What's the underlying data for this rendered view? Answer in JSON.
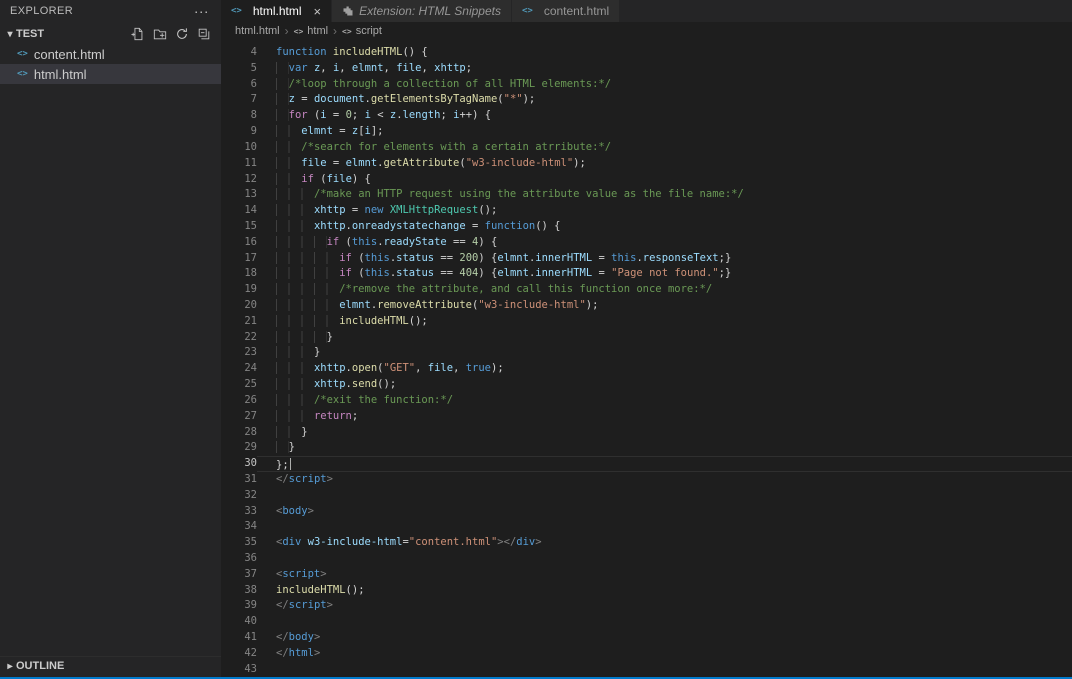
{
  "colors": {
    "accent": "#007acc",
    "editor_bg": "#1e1e1e",
    "sidebar_bg": "#252526",
    "selection_bg": "#37373d",
    "tab_inactive_bg": "#2d2d2d",
    "comment": "#6a9955",
    "keyword": "#569cd6",
    "control_keyword": "#c586c0",
    "string": "#ce9178",
    "function_name": "#dcdcaa",
    "variable": "#9cdcfe"
  },
  "icons": {
    "html_file": "<>",
    "close": "×",
    "more": "···",
    "chevron_down": "▾",
    "chevron_right": "▸",
    "breadcrumb_sep": "›",
    "crumb_symbol": "<>"
  },
  "sidebar": {
    "title": "EXPLORER",
    "section": "TEST",
    "files": [
      {
        "name": "content.html",
        "selected": false
      },
      {
        "name": "html.html",
        "selected": true
      }
    ],
    "outline_label": "OUTLINE"
  },
  "tabs": [
    {
      "label": "html.html",
      "active": true
    },
    {
      "label": "Extension: HTML Snippets",
      "preview": true
    },
    {
      "label": "content.html"
    }
  ],
  "breadcrumb": {
    "items": [
      "html.html",
      "html",
      "script"
    ]
  },
  "editor": {
    "language": "html",
    "current_line": 30,
    "lines": [
      {
        "n": 4,
        "t": [
          [
            "k",
            "function"
          ],
          [
            "p",
            " "
          ],
          [
            "f",
            "includeHTML"
          ],
          [
            "p",
            "() {"
          ]
        ]
      },
      {
        "n": 5,
        "t": [
          [
            "p",
            "  "
          ],
          [
            "k",
            "var"
          ],
          [
            "p",
            " "
          ],
          [
            "v",
            "z"
          ],
          [
            "p",
            ", "
          ],
          [
            "v",
            "i"
          ],
          [
            "p",
            ", "
          ],
          [
            "v",
            "elmnt"
          ],
          [
            "p",
            ", "
          ],
          [
            "v",
            "file"
          ],
          [
            "p",
            ", "
          ],
          [
            "v",
            "xhttp"
          ],
          [
            "p",
            ";"
          ]
        ]
      },
      {
        "n": 6,
        "t": [
          [
            "p",
            "  "
          ],
          [
            "c",
            "/*loop through a collection of all HTML elements:*/"
          ]
        ]
      },
      {
        "n": 7,
        "t": [
          [
            "p",
            "  "
          ],
          [
            "v",
            "z"
          ],
          [
            "p",
            " = "
          ],
          [
            "v",
            "document"
          ],
          [
            "p",
            "."
          ],
          [
            "f",
            "getElementsByTagName"
          ],
          [
            "p",
            "("
          ],
          [
            "s",
            "\"*\""
          ],
          [
            "p",
            ");"
          ]
        ]
      },
      {
        "n": 8,
        "t": [
          [
            "p",
            "  "
          ],
          [
            "ct",
            "for"
          ],
          [
            "p",
            " ("
          ],
          [
            "v",
            "i"
          ],
          [
            "p",
            " = "
          ],
          [
            "n",
            "0"
          ],
          [
            "p",
            "; "
          ],
          [
            "v",
            "i"
          ],
          [
            "p",
            " < "
          ],
          [
            "v",
            "z"
          ],
          [
            "p",
            "."
          ],
          [
            "v",
            "length"
          ],
          [
            "p",
            "; "
          ],
          [
            "v",
            "i"
          ],
          [
            "p",
            "++) {"
          ]
        ]
      },
      {
        "n": 9,
        "t": [
          [
            "p",
            "    "
          ],
          [
            "v",
            "elmnt"
          ],
          [
            "p",
            " = "
          ],
          [
            "v",
            "z"
          ],
          [
            "p",
            "["
          ],
          [
            "v",
            "i"
          ],
          [
            "p",
            "];"
          ]
        ]
      },
      {
        "n": 10,
        "t": [
          [
            "p",
            "    "
          ],
          [
            "c",
            "/*search for elements with a certain atrribute:*/"
          ]
        ]
      },
      {
        "n": 11,
        "t": [
          [
            "p",
            "    "
          ],
          [
            "v",
            "file"
          ],
          [
            "p",
            " = "
          ],
          [
            "v",
            "elmnt"
          ],
          [
            "p",
            "."
          ],
          [
            "f",
            "getAttribute"
          ],
          [
            "p",
            "("
          ],
          [
            "s",
            "\"w3-include-html\""
          ],
          [
            "p",
            ");"
          ]
        ]
      },
      {
        "n": 12,
        "t": [
          [
            "p",
            "    "
          ],
          [
            "ct",
            "if"
          ],
          [
            "p",
            " ("
          ],
          [
            "v",
            "file"
          ],
          [
            "p",
            ") {"
          ]
        ]
      },
      {
        "n": 13,
        "t": [
          [
            "p",
            "      "
          ],
          [
            "c",
            "/*make an HTTP request using the attribute value as the file name:*/"
          ]
        ]
      },
      {
        "n": 14,
        "t": [
          [
            "p",
            "      "
          ],
          [
            "v",
            "xhttp"
          ],
          [
            "p",
            " = "
          ],
          [
            "k",
            "new"
          ],
          [
            "p",
            " "
          ],
          [
            "cl",
            "XMLHttpRequest"
          ],
          [
            "p",
            "();"
          ]
        ]
      },
      {
        "n": 15,
        "t": [
          [
            "p",
            "      "
          ],
          [
            "v",
            "xhttp"
          ],
          [
            "p",
            "."
          ],
          [
            "v",
            "onreadystatechange"
          ],
          [
            "p",
            " = "
          ],
          [
            "k",
            "function"
          ],
          [
            "p",
            "() {"
          ]
        ]
      },
      {
        "n": 16,
        "t": [
          [
            "p",
            "        "
          ],
          [
            "ct",
            "if"
          ],
          [
            "p",
            " ("
          ],
          [
            "k",
            "this"
          ],
          [
            "p",
            "."
          ],
          [
            "v",
            "readyState"
          ],
          [
            "p",
            " == "
          ],
          [
            "n",
            "4"
          ],
          [
            "p",
            ") {"
          ]
        ]
      },
      {
        "n": 17,
        "t": [
          [
            "p",
            "          "
          ],
          [
            "ct",
            "if"
          ],
          [
            "p",
            " ("
          ],
          [
            "k",
            "this"
          ],
          [
            "p",
            "."
          ],
          [
            "v",
            "status"
          ],
          [
            "p",
            " == "
          ],
          [
            "n",
            "200"
          ],
          [
            "p",
            ") {"
          ],
          [
            "v",
            "elmnt"
          ],
          [
            "p",
            "."
          ],
          [
            "v",
            "innerHTML"
          ],
          [
            "p",
            " = "
          ],
          [
            "k",
            "this"
          ],
          [
            "p",
            "."
          ],
          [
            "v",
            "responseText"
          ],
          [
            "p",
            ";}"
          ]
        ]
      },
      {
        "n": 18,
        "t": [
          [
            "p",
            "          "
          ],
          [
            "ct",
            "if"
          ],
          [
            "p",
            " ("
          ],
          [
            "k",
            "this"
          ],
          [
            "p",
            "."
          ],
          [
            "v",
            "status"
          ],
          [
            "p",
            " == "
          ],
          [
            "n",
            "404"
          ],
          [
            "p",
            ") {"
          ],
          [
            "v",
            "elmnt"
          ],
          [
            "p",
            "."
          ],
          [
            "v",
            "innerHTML"
          ],
          [
            "p",
            " = "
          ],
          [
            "s",
            "\"Page not found.\""
          ],
          [
            "p",
            ";}"
          ]
        ]
      },
      {
        "n": 19,
        "t": [
          [
            "p",
            "          "
          ],
          [
            "c",
            "/*remove the attribute, and call this function once more:*/"
          ]
        ]
      },
      {
        "n": 20,
        "t": [
          [
            "p",
            "          "
          ],
          [
            "v",
            "elmnt"
          ],
          [
            "p",
            "."
          ],
          [
            "f",
            "removeAttribute"
          ],
          [
            "p",
            "("
          ],
          [
            "s",
            "\"w3-include-html\""
          ],
          [
            "p",
            ");"
          ]
        ]
      },
      {
        "n": 21,
        "t": [
          [
            "p",
            "          "
          ],
          [
            "f",
            "includeHTML"
          ],
          [
            "p",
            "();"
          ]
        ]
      },
      {
        "n": 22,
        "t": [
          [
            "p",
            "        "
          ],
          [
            "p",
            "}"
          ]
        ]
      },
      {
        "n": 23,
        "t": [
          [
            "p",
            "      "
          ],
          [
            "p",
            "}"
          ]
        ]
      },
      {
        "n": 24,
        "t": [
          [
            "p",
            "      "
          ],
          [
            "v",
            "xhttp"
          ],
          [
            "p",
            "."
          ],
          [
            "f",
            "open"
          ],
          [
            "p",
            "("
          ],
          [
            "s",
            "\"GET\""
          ],
          [
            "p",
            ", "
          ],
          [
            "v",
            "file"
          ],
          [
            "p",
            ", "
          ],
          [
            "k",
            "true"
          ],
          [
            "p",
            ");"
          ]
        ]
      },
      {
        "n": 25,
        "t": [
          [
            "p",
            "      "
          ],
          [
            "v",
            "xhttp"
          ],
          [
            "p",
            "."
          ],
          [
            "f",
            "send"
          ],
          [
            "p",
            "();"
          ]
        ]
      },
      {
        "n": 26,
        "t": [
          [
            "p",
            "      "
          ],
          [
            "c",
            "/*exit the function:*/"
          ]
        ]
      },
      {
        "n": 27,
        "t": [
          [
            "p",
            "      "
          ],
          [
            "ct",
            "return"
          ],
          [
            "p",
            ";"
          ]
        ]
      },
      {
        "n": 28,
        "t": [
          [
            "p",
            "    "
          ],
          [
            "p",
            "}"
          ]
        ]
      },
      {
        "n": 29,
        "t": [
          [
            "p",
            "  "
          ],
          [
            "p",
            "}"
          ]
        ]
      },
      {
        "n": 30,
        "t": [
          [
            "p",
            "};"
          ]
        ]
      },
      {
        "n": 31,
        "t": [
          [
            "tp",
            "</"
          ],
          [
            "t",
            "script"
          ],
          [
            "tp",
            ">"
          ]
        ]
      },
      {
        "n": 32,
        "t": []
      },
      {
        "n": 33,
        "t": [
          [
            "tp",
            "<"
          ],
          [
            "t",
            "body"
          ],
          [
            "tp",
            ">"
          ]
        ]
      },
      {
        "n": 34,
        "t": []
      },
      {
        "n": 35,
        "t": [
          [
            "tp",
            "<"
          ],
          [
            "t",
            "div"
          ],
          [
            "p",
            " "
          ],
          [
            "a",
            "w3-include-html"
          ],
          [
            "p",
            "="
          ],
          [
            "s",
            "\"content.html\""
          ],
          [
            "tp",
            "></"
          ],
          [
            "t",
            "div"
          ],
          [
            "tp",
            ">"
          ]
        ]
      },
      {
        "n": 36,
        "t": []
      },
      {
        "n": 37,
        "t": [
          [
            "tp",
            "<"
          ],
          [
            "t",
            "script"
          ],
          [
            "tp",
            ">"
          ]
        ]
      },
      {
        "n": 38,
        "t": [
          [
            "f",
            "includeHTML"
          ],
          [
            "p",
            "();"
          ]
        ]
      },
      {
        "n": 39,
        "t": [
          [
            "tp",
            "</"
          ],
          [
            "t",
            "script"
          ],
          [
            "tp",
            ">"
          ]
        ]
      },
      {
        "n": 40,
        "t": []
      },
      {
        "n": 41,
        "t": [
          [
            "tp",
            "</"
          ],
          [
            "t",
            "body"
          ],
          [
            "tp",
            ">"
          ]
        ]
      },
      {
        "n": 42,
        "t": [
          [
            "tp",
            "</"
          ],
          [
            "t",
            "html"
          ],
          [
            "tp",
            ">"
          ]
        ]
      },
      {
        "n": 43,
        "t": []
      }
    ]
  }
}
